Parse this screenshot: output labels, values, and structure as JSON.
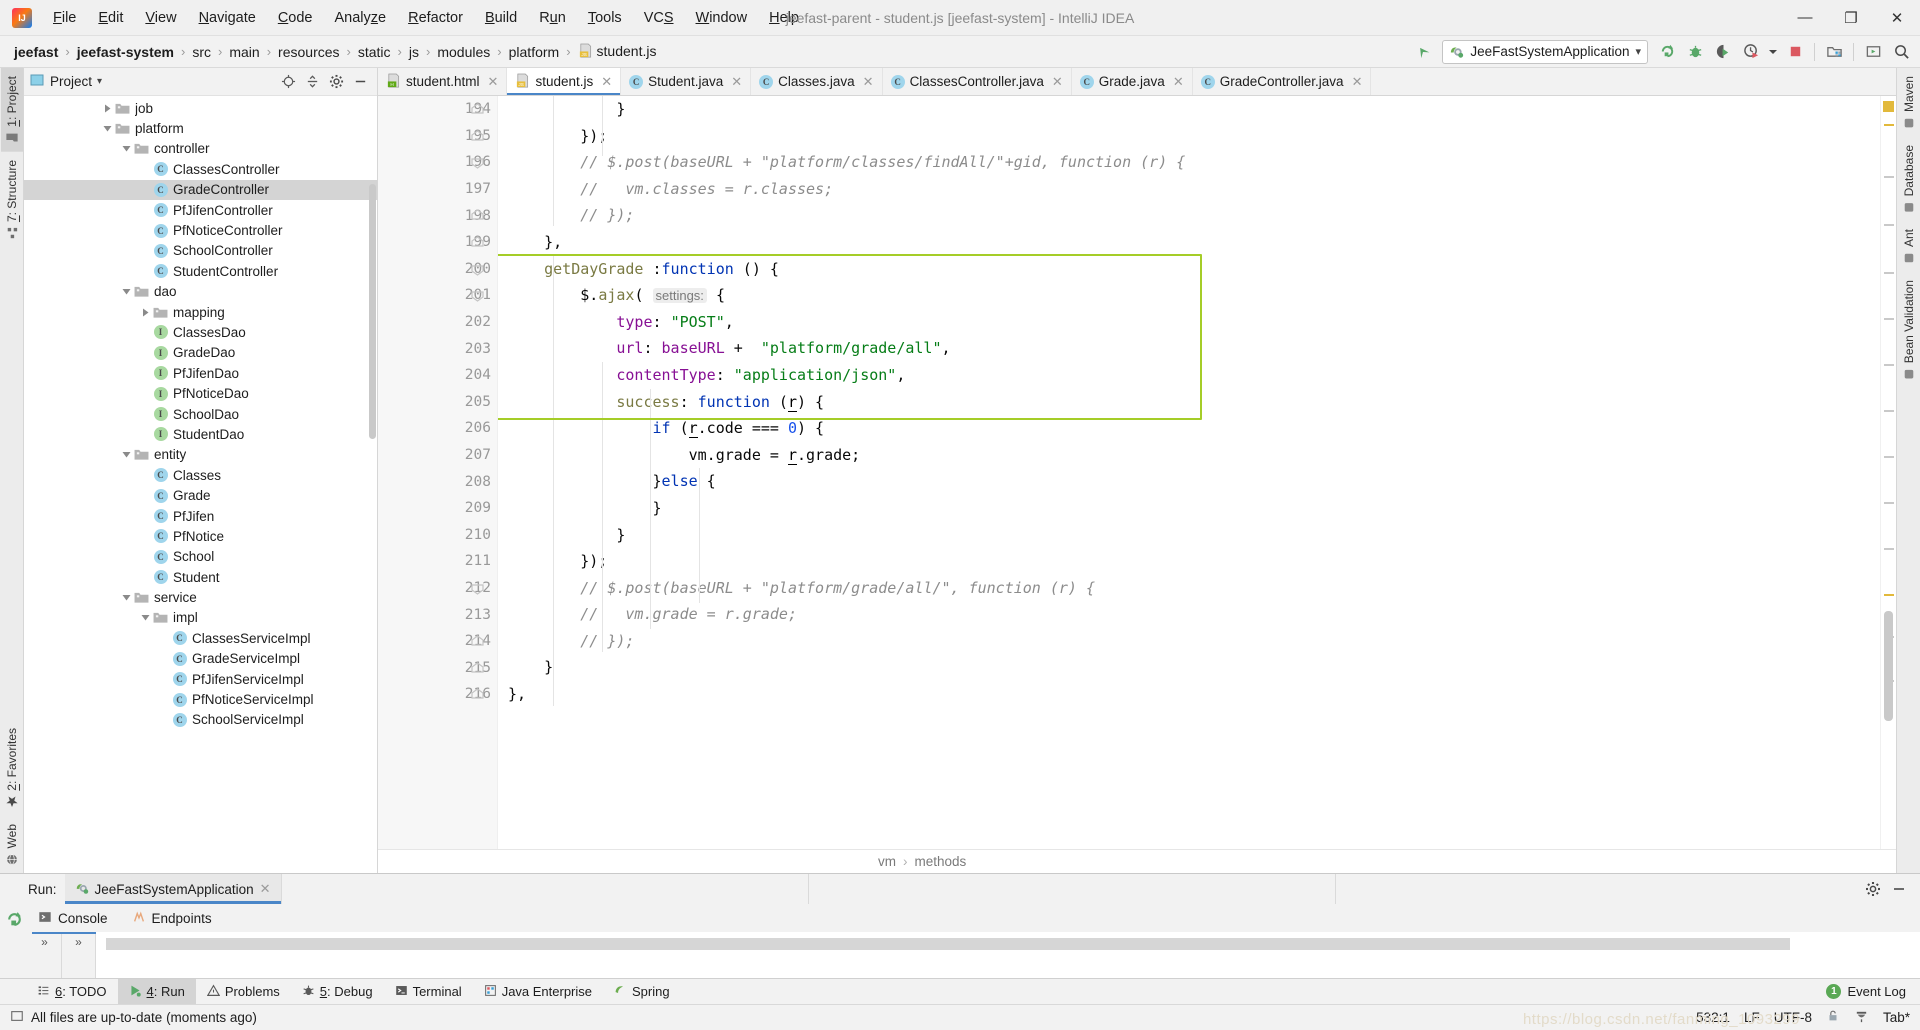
{
  "window": {
    "title": "jeefast-parent - student.js [jeefast-system] - IntelliJ IDEA",
    "minimize": "—",
    "maximize": "❐",
    "close": "✕"
  },
  "menu": [
    {
      "label": "File",
      "mnemonic": "F"
    },
    {
      "label": "Edit",
      "mnemonic": "E"
    },
    {
      "label": "View",
      "mnemonic": "V"
    },
    {
      "label": "Navigate",
      "mnemonic": "N"
    },
    {
      "label": "Code",
      "mnemonic": "C"
    },
    {
      "label": "Analyze",
      "mnemonic": "z"
    },
    {
      "label": "Refactor",
      "mnemonic": "R"
    },
    {
      "label": "Build",
      "mnemonic": "B"
    },
    {
      "label": "Run",
      "mnemonic": "u"
    },
    {
      "label": "Tools",
      "mnemonic": "T"
    },
    {
      "label": "VCS",
      "mnemonic": "S"
    },
    {
      "label": "Window",
      "mnemonic": "W"
    },
    {
      "label": "Help",
      "mnemonic": "H"
    }
  ],
  "breadcrumbs": [
    {
      "label": "jeefast",
      "bold": true
    },
    {
      "label": "jeefast-system",
      "bold": true
    },
    {
      "label": "src",
      "bold": false
    },
    {
      "label": "main",
      "bold": false
    },
    {
      "label": "resources",
      "bold": false
    },
    {
      "label": "static",
      "bold": false
    },
    {
      "label": "js",
      "bold": false
    },
    {
      "label": "modules",
      "bold": false
    },
    {
      "label": "platform",
      "bold": false
    },
    {
      "label": "student.js",
      "bold": false,
      "icon": "js-file-icon"
    }
  ],
  "toolbar": {
    "back_icon": "back-arrow-icon",
    "run_config": "JeeFastSystemApplication",
    "run_config_caret": "▾",
    "buttons": [
      {
        "name": "rerun-icon",
        "title": "Rerun"
      },
      {
        "name": "debug-icon",
        "title": "Debug"
      },
      {
        "name": "coverage-icon",
        "title": "Run with Coverage"
      },
      {
        "name": "profiler-icon",
        "title": "Profiler"
      },
      {
        "name": "stop-icon",
        "title": "Stop"
      },
      {
        "name": "project-structure-icon",
        "title": "Project Structure"
      },
      {
        "name": "updates-icon",
        "title": "Update Project"
      },
      {
        "name": "search-icon",
        "title": "Search Everywhere"
      }
    ]
  },
  "left_strip": [
    {
      "label": "1: Project",
      "mnemonic": "1",
      "icon": "project-icon",
      "active": true
    },
    {
      "label": "7: Structure",
      "mnemonic": "7",
      "icon": "structure-icon",
      "active": false
    },
    {
      "label": "2: Favorites",
      "mnemonic": "2",
      "icon": "favorites-star-icon",
      "active": false
    },
    {
      "label": "Web",
      "mnemonic": "",
      "icon": "web-globe-icon",
      "active": false
    }
  ],
  "right_strip": [
    {
      "label": "Maven",
      "icon": "maven-icon"
    },
    {
      "label": "Database",
      "icon": "database-icon"
    },
    {
      "label": "Ant",
      "icon": "ant-icon"
    },
    {
      "label": "Bean Validation",
      "icon": "bean-icon"
    }
  ],
  "project_panel": {
    "title": "Project",
    "caret": "▾",
    "actions": [
      "locate-icon",
      "collapse-all-icon",
      "gear-icon",
      "hide-icon"
    ],
    "tree": [
      {
        "label": "job",
        "indent": 4,
        "twist": "collapsed",
        "icon": "folder"
      },
      {
        "label": "platform",
        "indent": 4,
        "twist": "expanded",
        "icon": "folder"
      },
      {
        "label": "controller",
        "indent": 5,
        "twist": "expanded",
        "icon": "folder"
      },
      {
        "label": "ClassesController",
        "indent": 6,
        "twist": "none",
        "icon": "class"
      },
      {
        "label": "GradeController",
        "indent": 6,
        "twist": "none",
        "icon": "class",
        "selected": true
      },
      {
        "label": "PfJifenController",
        "indent": 6,
        "twist": "none",
        "icon": "class"
      },
      {
        "label": "PfNoticeController",
        "indent": 6,
        "twist": "none",
        "icon": "class"
      },
      {
        "label": "SchoolController",
        "indent": 6,
        "twist": "none",
        "icon": "class"
      },
      {
        "label": "StudentController",
        "indent": 6,
        "twist": "none",
        "icon": "class"
      },
      {
        "label": "dao",
        "indent": 5,
        "twist": "expanded",
        "icon": "folder"
      },
      {
        "label": "mapping",
        "indent": 6,
        "twist": "collapsed",
        "icon": "folder"
      },
      {
        "label": "ClassesDao",
        "indent": 6,
        "twist": "none",
        "icon": "interface"
      },
      {
        "label": "GradeDao",
        "indent": 6,
        "twist": "none",
        "icon": "interface"
      },
      {
        "label": "PfJifenDao",
        "indent": 6,
        "twist": "none",
        "icon": "interface"
      },
      {
        "label": "PfNoticeDao",
        "indent": 6,
        "twist": "none",
        "icon": "interface"
      },
      {
        "label": "SchoolDao",
        "indent": 6,
        "twist": "none",
        "icon": "interface"
      },
      {
        "label": "StudentDao",
        "indent": 6,
        "twist": "none",
        "icon": "interface"
      },
      {
        "label": "entity",
        "indent": 5,
        "twist": "expanded",
        "icon": "folder"
      },
      {
        "label": "Classes",
        "indent": 6,
        "twist": "none",
        "icon": "class"
      },
      {
        "label": "Grade",
        "indent": 6,
        "twist": "none",
        "icon": "class"
      },
      {
        "label": "PfJifen",
        "indent": 6,
        "twist": "none",
        "icon": "class"
      },
      {
        "label": "PfNotice",
        "indent": 6,
        "twist": "none",
        "icon": "class"
      },
      {
        "label": "School",
        "indent": 6,
        "twist": "none",
        "icon": "class"
      },
      {
        "label": "Student",
        "indent": 6,
        "twist": "none",
        "icon": "class"
      },
      {
        "label": "service",
        "indent": 5,
        "twist": "expanded",
        "icon": "folder"
      },
      {
        "label": "impl",
        "indent": 6,
        "twist": "expanded",
        "icon": "folder"
      },
      {
        "label": "ClassesServiceImpl",
        "indent": 7,
        "twist": "none",
        "icon": "class"
      },
      {
        "label": "GradeServiceImpl",
        "indent": 7,
        "twist": "none",
        "icon": "class"
      },
      {
        "label": "PfJifenServiceImpl",
        "indent": 7,
        "twist": "none",
        "icon": "class"
      },
      {
        "label": "PfNoticeServiceImpl",
        "indent": 7,
        "twist": "none",
        "icon": "class"
      },
      {
        "label": "SchoolServiceImpl",
        "indent": 7,
        "twist": "none",
        "icon": "class"
      }
    ]
  },
  "editor_tabs": [
    {
      "label": "student.html",
      "icon": "html-file-icon",
      "active": false
    },
    {
      "label": "student.js",
      "icon": "js-file-icon",
      "active": true
    },
    {
      "label": "Student.java",
      "icon": "class",
      "active": false
    },
    {
      "label": "Classes.java",
      "icon": "class",
      "active": false
    },
    {
      "label": "ClassesController.java",
      "icon": "class",
      "active": false
    },
    {
      "label": "Grade.java",
      "icon": "class",
      "active": false
    },
    {
      "label": "GradeController.java",
      "icon": "class",
      "active": false
    }
  ],
  "editor": {
    "first_line": 194,
    "line_numbers": [
      194,
      195,
      196,
      197,
      198,
      199,
      200,
      201,
      202,
      203,
      204,
      205,
      206,
      207,
      208,
      209,
      210,
      211,
      212,
      213,
      214,
      215,
      216
    ],
    "highlight_color": "#a5cd28",
    "code_lines": [
      {
        "n": 194,
        "indent": 0,
        "tokens": [
          {
            "t": "            }",
            "c": "pln"
          }
        ]
      },
      {
        "n": 195,
        "indent": 0,
        "tokens": [
          {
            "t": "        });",
            "c": "pln"
          }
        ]
      },
      {
        "n": 196,
        "indent": 0,
        "tokens": [
          {
            "t": "        // $.post(baseURL + \"platform/classes/findAll/\"+gid, function (r) {",
            "c": "cmt"
          }
        ]
      },
      {
        "n": 197,
        "indent": 0,
        "tokens": [
          {
            "t": "        //   vm.classes = r.classes;",
            "c": "cmt"
          }
        ]
      },
      {
        "n": 198,
        "indent": 0,
        "tokens": [
          {
            "t": "        // });",
            "c": "cmt"
          }
        ]
      },
      {
        "n": 199,
        "indent": 0,
        "tokens": [
          {
            "t": "    },",
            "c": "pln"
          }
        ]
      },
      {
        "n": 200,
        "indent": 0,
        "tokens": [
          {
            "t": "    ",
            "c": "pln"
          },
          {
            "t": "getDayGrade",
            "c": "fn"
          },
          {
            "t": " :",
            "c": "pln"
          },
          {
            "t": "function",
            "c": "kw"
          },
          {
            "t": " () {",
            "c": "pln"
          }
        ]
      },
      {
        "n": 201,
        "indent": 0,
        "tokens": [
          {
            "t": "        $.",
            "c": "pln"
          },
          {
            "t": "ajax",
            "c": "fn"
          },
          {
            "t": "( ",
            "c": "pln"
          },
          {
            "t": "settings:",
            "c": "hint"
          },
          {
            "t": " {",
            "c": "pln"
          }
        ]
      },
      {
        "n": 202,
        "indent": 0,
        "tokens": [
          {
            "t": "            ",
            "c": "pln"
          },
          {
            "t": "type",
            "c": "prop"
          },
          {
            "t": ": ",
            "c": "pln"
          },
          {
            "t": "\"POST\"",
            "c": "str"
          },
          {
            "t": ",",
            "c": "pln"
          }
        ]
      },
      {
        "n": 203,
        "indent": 0,
        "tokens": [
          {
            "t": "            ",
            "c": "pln"
          },
          {
            "t": "url",
            "c": "prop"
          },
          {
            "t": ": ",
            "c": "pln"
          },
          {
            "t": "baseURL",
            "c": "prop"
          },
          {
            "t": " +  ",
            "c": "pln"
          },
          {
            "t": "\"platform/grade/all\"",
            "c": "str"
          },
          {
            "t": ",",
            "c": "pln"
          }
        ]
      },
      {
        "n": 204,
        "indent": 0,
        "tokens": [
          {
            "t": "            ",
            "c": "pln"
          },
          {
            "t": "contentType",
            "c": "prop"
          },
          {
            "t": ": ",
            "c": "pln"
          },
          {
            "t": "\"application/json\"",
            "c": "str"
          },
          {
            "t": ",",
            "c": "pln"
          }
        ]
      },
      {
        "n": 205,
        "indent": 0,
        "tokens": [
          {
            "t": "            ",
            "c": "pln"
          },
          {
            "t": "success",
            "c": "fn"
          },
          {
            "t": ": ",
            "c": "pln"
          },
          {
            "t": "function",
            "c": "kw"
          },
          {
            "t": " (",
            "c": "pln"
          },
          {
            "t": "r",
            "c": "local"
          },
          {
            "t": ") {",
            "c": "pln"
          }
        ]
      },
      {
        "n": 206,
        "indent": 0,
        "tokens": [
          {
            "t": "                ",
            "c": "pln"
          },
          {
            "t": "if",
            "c": "kw"
          },
          {
            "t": " (",
            "c": "pln"
          },
          {
            "t": "r",
            "c": "local"
          },
          {
            "t": ".code === ",
            "c": "pln"
          },
          {
            "t": "0",
            "c": "num"
          },
          {
            "t": ") {",
            "c": "pln"
          }
        ]
      },
      {
        "n": 207,
        "indent": 0,
        "tokens": [
          {
            "t": "                    vm.grade = ",
            "c": "pln"
          },
          {
            "t": "r",
            "c": "local"
          },
          {
            "t": ".grade;",
            "c": "pln"
          }
        ]
      },
      {
        "n": 208,
        "indent": 0,
        "tokens": [
          {
            "t": "                }",
            "c": "pln"
          },
          {
            "t": "else",
            "c": "kw"
          },
          {
            "t": " {",
            "c": "pln"
          }
        ]
      },
      {
        "n": 209,
        "indent": 0,
        "tokens": [
          {
            "t": "                }",
            "c": "pln"
          }
        ]
      },
      {
        "n": 210,
        "indent": 0,
        "tokens": [
          {
            "t": "            }",
            "c": "pln"
          }
        ]
      },
      {
        "n": 211,
        "indent": 0,
        "tokens": [
          {
            "t": "        });",
            "c": "pln"
          }
        ]
      },
      {
        "n": 212,
        "indent": 0,
        "tokens": [
          {
            "t": "        // $.post(baseURL + \"platform/grade/all/\", function (r) {",
            "c": "cmt"
          }
        ]
      },
      {
        "n": 213,
        "indent": 0,
        "tokens": [
          {
            "t": "        //   vm.grade = r.grade;",
            "c": "cmt"
          }
        ]
      },
      {
        "n": 214,
        "indent": 0,
        "tokens": [
          {
            "t": "        // });",
            "c": "cmt"
          }
        ]
      },
      {
        "n": 215,
        "indent": 0,
        "tokens": [
          {
            "t": "    }",
            "c": "pln"
          }
        ]
      },
      {
        "n": 216,
        "indent": 0,
        "tokens": [
          {
            "t": "},",
            "c": "pln"
          }
        ]
      }
    ],
    "structure_crumbs": [
      "vm",
      "methods"
    ],
    "crumb_sep": "›"
  },
  "run_panel": {
    "label": "Run:",
    "tab": "JeeFastSystemApplication",
    "tab_close": "✕",
    "tabs": [
      {
        "label": "Console",
        "icon": "console-icon",
        "active": true
      },
      {
        "label": "Endpoints",
        "icon": "endpoints-icon",
        "active": false
      }
    ],
    "side_buttons": [
      "rerun-icon",
      "stop-icon"
    ],
    "expand_chevrons": "»",
    "settings_icon": "gear-icon",
    "hide_icon": "hide-icon"
  },
  "bottom_tabs": [
    {
      "label": "6: TODO",
      "mnemonic": "6",
      "icon": "todo-icon",
      "active": false
    },
    {
      "label": "4: Run",
      "mnemonic": "4",
      "icon": "run-icon",
      "active": true
    },
    {
      "label": "Problems",
      "mnemonic": "",
      "icon": "problems-icon",
      "active": false
    },
    {
      "label": "5: Debug",
      "mnemonic": "5",
      "icon": "debug-icon",
      "active": false
    },
    {
      "label": "Terminal",
      "mnemonic": "",
      "icon": "terminal-icon",
      "active": false
    },
    {
      "label": "Java Enterprise",
      "mnemonic": "",
      "icon": "java-ee-icon",
      "active": false
    },
    {
      "label": "Spring",
      "mnemonic": "",
      "icon": "spring-icon",
      "active": false
    }
  ],
  "event_log": {
    "label": "Event Log",
    "count": "1"
  },
  "statusbar": {
    "message": "All files are up-to-date (moments ago)",
    "caret_position": "532:1",
    "line_separator": "LF",
    "encoding": "UTF-8",
    "lock_icon": "lock-icon",
    "inspection_icon": "inspection-profile-icon",
    "indent": "Tab*",
    "watermark": "https://blog.csdn.net/fanming_1093299"
  }
}
